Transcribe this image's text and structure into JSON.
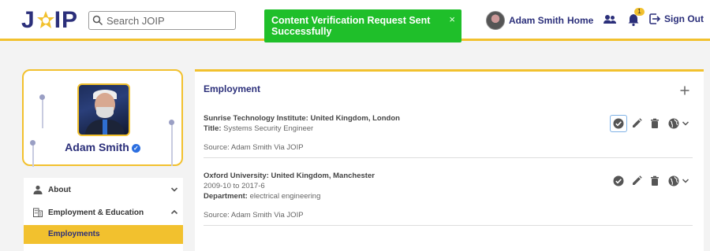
{
  "header": {
    "logo_left": "J",
    "logo_right": "IP",
    "search_placeholder": "Search JOIP",
    "user_name": "Adam Smith",
    "home_label": "Home",
    "notification_count": "1",
    "signout_label": "Sign Out",
    "accent_color": "#f2c12e",
    "brand_color": "#2b2f7a"
  },
  "toast": {
    "message": "Content Verification Request Sent Successfully",
    "close": "×",
    "color": "#1fbf2a"
  },
  "profile": {
    "name": "Adam Smith",
    "verified_mark": "✓"
  },
  "side_menu": {
    "items": [
      {
        "label": "About",
        "icon": "person-icon",
        "chevron": "chevron-down-icon"
      },
      {
        "label": "Employment & Education",
        "icon": "building-icon",
        "chevron": "chevron-up-icon"
      }
    ],
    "active_sub": "Employments"
  },
  "main": {
    "title": "Employment",
    "entries": [
      {
        "org": "Sunrise Technology Institute: United Kingdom, London",
        "field_label": "Title:",
        "field_value": " Systems Security Engineer",
        "source": "Source: Adam Smith Via JOIP"
      },
      {
        "org": "Oxford University: United Kingdom, Manchester",
        "dates": "2009-10 to 2017-6",
        "field_label": "Department:",
        "field_value": " electrical engineering",
        "source": "Source: Adam Smith Via JOIP"
      }
    ]
  }
}
